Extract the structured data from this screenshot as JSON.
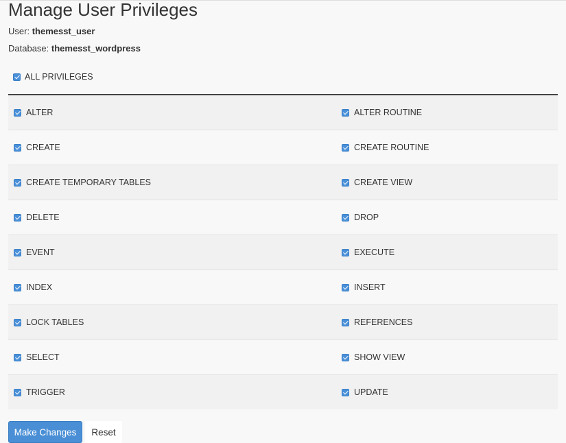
{
  "page": {
    "title": "Manage User Privileges",
    "user_label": "User:",
    "user_value": "themesst_user",
    "database_label": "Database:",
    "database_value": "themesst_wordpress"
  },
  "all_privileges": {
    "label": "ALL PRIVILEGES",
    "checked": true
  },
  "privileges": [
    {
      "left": "ALTER",
      "right": "ALTER ROUTINE"
    },
    {
      "left": "CREATE",
      "right": "CREATE ROUTINE"
    },
    {
      "left": "CREATE TEMPORARY TABLES",
      "right": "CREATE VIEW"
    },
    {
      "left": "DELETE",
      "right": "DROP"
    },
    {
      "left": "EVENT",
      "right": "EXECUTE"
    },
    {
      "left": "INDEX",
      "right": "INSERT"
    },
    {
      "left": "LOCK TABLES",
      "right": "REFERENCES"
    },
    {
      "left": "SELECT",
      "right": "SHOW VIEW"
    },
    {
      "left": "TRIGGER",
      "right": "UPDATE"
    }
  ],
  "actions": {
    "submit_label": "Make Changes",
    "reset_label": "Reset"
  },
  "colors": {
    "accent": "#4a8fd5",
    "checkbox": "#4a90d9"
  }
}
